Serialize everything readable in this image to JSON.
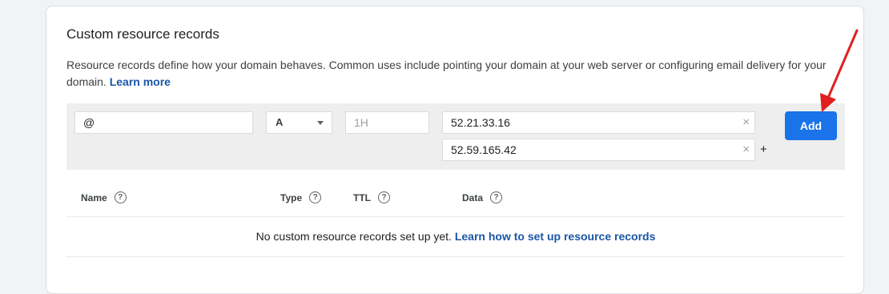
{
  "section": {
    "title": "Custom resource records",
    "description": "Resource records define how your domain behaves. Common uses include pointing your domain at your web server or configuring email delivery for your domain.",
    "learn_more": "Learn more"
  },
  "form": {
    "name_value": "@",
    "type_value": "A",
    "ttl_placeholder": "1H",
    "data_values": [
      "52.21.33.16",
      "52.59.165.42"
    ],
    "clear_glyph": "×",
    "add_data_glyph": "+",
    "add_button": "Add"
  },
  "table": {
    "columns": [
      "Name",
      "Type",
      "TTL",
      "Data"
    ],
    "help_glyph": "?",
    "empty_text": "No custom resource records set up yet.",
    "empty_link": "Learn how to set up resource records"
  },
  "colors": {
    "accent": "#1a73e8",
    "link": "#1a56a7",
    "annotation_arrow": "#e02020"
  },
  "icons": {
    "help": "help-circle-icon",
    "clear": "close-icon",
    "dropdown": "chevron-down-icon",
    "annotation": "red-arrow-icon"
  }
}
